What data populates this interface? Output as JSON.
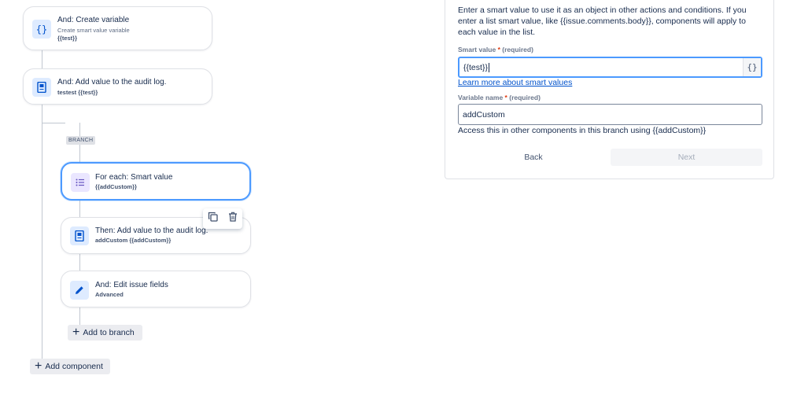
{
  "flow": {
    "cards": [
      {
        "title": "And: Create variable",
        "sub": "Create smart value variable",
        "sub2": "{{test}}",
        "icon": "braces-icon"
      },
      {
        "title": "And: Add value to the audit log.",
        "sub2": "testest {{test}}",
        "icon": "audit-log-icon"
      }
    ],
    "branch_label": "BRANCH",
    "branch_cards": [
      {
        "title": "For each: Smart value",
        "sub2": "{{addCustom}}",
        "icon": "list-icon"
      },
      {
        "title": "Then: Add value to the audit log.",
        "sub2": "addCustom {{addCustom}}",
        "icon": "audit-log-icon"
      },
      {
        "title": "And: Edit issue fields",
        "sub2": "Advanced",
        "icon": "pencil-icon"
      }
    ],
    "add_to_branch": "Add to branch",
    "add_component": "Add component",
    "hover_tools": [
      "copy-icon",
      "trash-icon"
    ]
  },
  "panel": {
    "description": "Enter a smart value to use it as an object in other actions and conditions. If you enter a list smart value, like {{issue.comments.body}}, components will apply to each value in the list.",
    "smart_value": {
      "label": "Smart value",
      "required_mark": "*",
      "required_text": "(required)",
      "value": "{{test}}",
      "suffix": "{}"
    },
    "learn_more": "Learn more about smart values",
    "variable_name": {
      "label": "Variable name",
      "required_mark": "*",
      "required_text": "(required)",
      "value": "addCustom"
    },
    "help_text": "Access this in other components in this branch using {{addCustom}}",
    "back": "Back",
    "next": "Next"
  },
  "colors": {
    "accent": "#4c9aff",
    "link": "#0052cc",
    "required": "#de350b"
  }
}
